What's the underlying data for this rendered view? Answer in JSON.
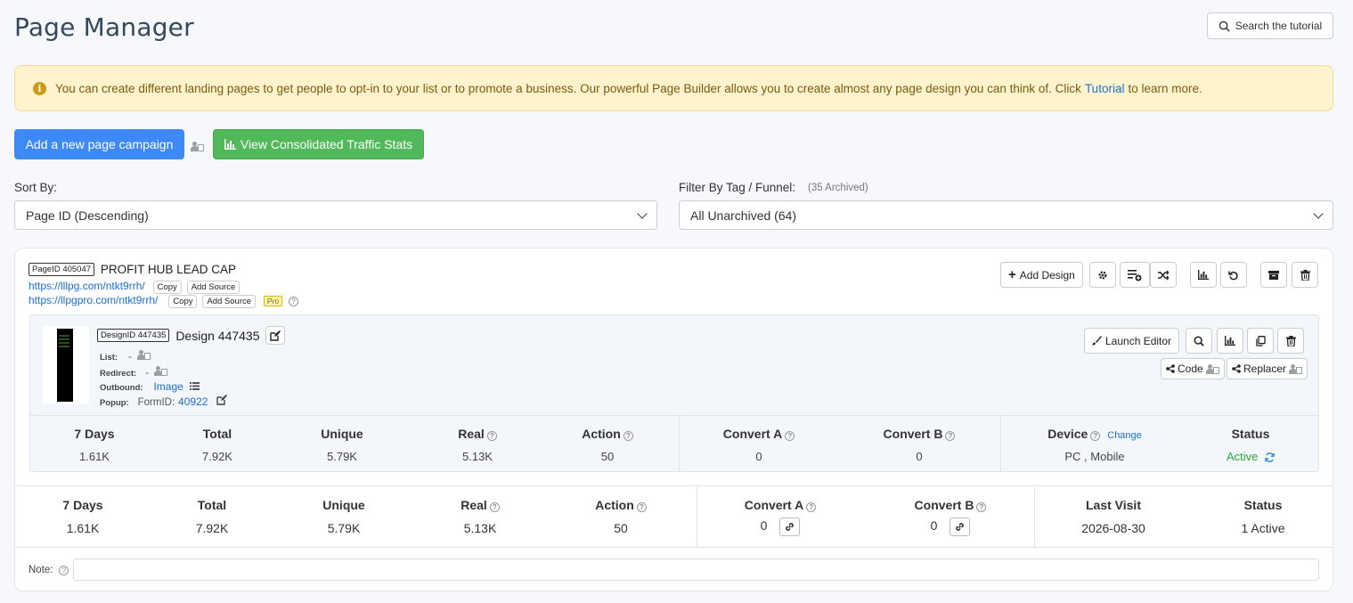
{
  "header": {
    "title": "Page Manager",
    "tutorial_button": "Search the tutorial"
  },
  "alert": {
    "text_before": "You can create different landing pages to get people to opt-in to your list or to promote a business. Our powerful Page Builder allows you to create almost any page design you can think of. Click",
    "link_text": "Tutorial",
    "text_after": "to learn more."
  },
  "actions": {
    "add_campaign": "Add a new page campaign",
    "view_stats": "View Consolidated Traffic Stats"
  },
  "sort": {
    "label": "Sort By:",
    "selected": "Page ID (Descending)"
  },
  "filter": {
    "label": "Filter By Tag / Funnel:",
    "archived_note": "(35 Archived)",
    "selected": "All Unarchived (64)"
  },
  "campaign": {
    "id_badge": "PageID 405047",
    "title": "PROFIT HUB LEAD CAP",
    "url1": "https://lllpg.com/ntkt9rrh/",
    "url2": "https://llpgpro.com/ntkt9rrh/",
    "copy": "Copy",
    "add_source": "Add Source",
    "pro": "Pro",
    "add_design": "Add Design",
    "design": {
      "id_badge": "DesignID 447435",
      "title": "Design 447435",
      "list_label": "List:",
      "list_value": "-",
      "redirect_label": "Redirect:",
      "redirect_value": "-",
      "outbound_label": "Outbound:",
      "outbound_value": "Image",
      "popup_label": "Popup:",
      "popup_form_label": "FormID:",
      "popup_form_id": "40922",
      "launch_editor": "Launch Editor",
      "code": "Code",
      "replacer": "Replacer",
      "stats": {
        "headers": [
          "7 Days",
          "Total",
          "Unique",
          "Real",
          "Action",
          "Convert A",
          "Convert B",
          "Device",
          "Status"
        ],
        "values": [
          "1.61K",
          "7.92K",
          "5.79K",
          "5.13K",
          "50",
          "0",
          "0",
          "PC , Mobile",
          "Active"
        ],
        "device_change": "Change"
      }
    },
    "stats": {
      "headers": [
        "7 Days",
        "Total",
        "Unique",
        "Real",
        "Action",
        "Convert A",
        "Convert B",
        "Last Visit",
        "Status"
      ],
      "values": [
        "1.61K",
        "7.92K",
        "5.79K",
        "5.13K",
        "50",
        "0",
        "0",
        "2026-08-30",
        "1 Active"
      ]
    },
    "note_label": "Note:"
  }
}
